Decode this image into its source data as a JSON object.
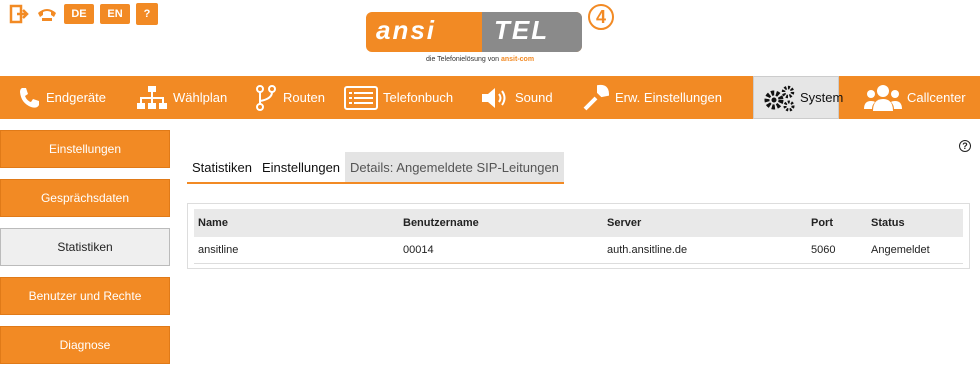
{
  "top": {
    "lang_de": "DE",
    "lang_en": "EN",
    "help": "?"
  },
  "logo": {
    "left": "ansi",
    "right": "TEL",
    "badge": "4",
    "subtitle_pre": "die Telefonielösung von",
    "subtitle_brand": "ansit-com"
  },
  "nav": {
    "items": [
      {
        "label": "Endgeräte",
        "icon": "phone-icon"
      },
      {
        "label": "Wählplan",
        "icon": "sitemap-icon"
      },
      {
        "label": "Routen",
        "icon": "route-icon"
      },
      {
        "label": "Telefonbuch",
        "icon": "list-icon"
      },
      {
        "label": "Sound",
        "icon": "speaker-icon"
      },
      {
        "label": "Erw. Einstellungen",
        "icon": "wrench-icon"
      },
      {
        "label": "System",
        "icon": "gears-icon"
      },
      {
        "label": "Callcenter",
        "icon": "users-icon"
      }
    ],
    "active": "System"
  },
  "sidebar": {
    "items": [
      "Einstellungen",
      "Gesprächsdaten",
      "Statistiken",
      "Benutzer und Rechte",
      "Diagnose"
    ],
    "active": "Statistiken"
  },
  "help_icon": "?",
  "subtabs": {
    "items": [
      "Statistiken",
      "Einstellungen",
      "Details: Angemeldete SIP-Leitungen"
    ],
    "active": "Details: Angemeldete SIP-Leitungen"
  },
  "table": {
    "headers": [
      "Name",
      "Benutzername",
      "Server",
      "Port",
      "Status"
    ],
    "rows": [
      [
        "ansitline",
        "00014",
        "auth.ansitline.de",
        "5060",
        "Angemeldet"
      ]
    ]
  },
  "colors": {
    "accent": "#f28a24",
    "active_bg": "#e6e6e6"
  }
}
